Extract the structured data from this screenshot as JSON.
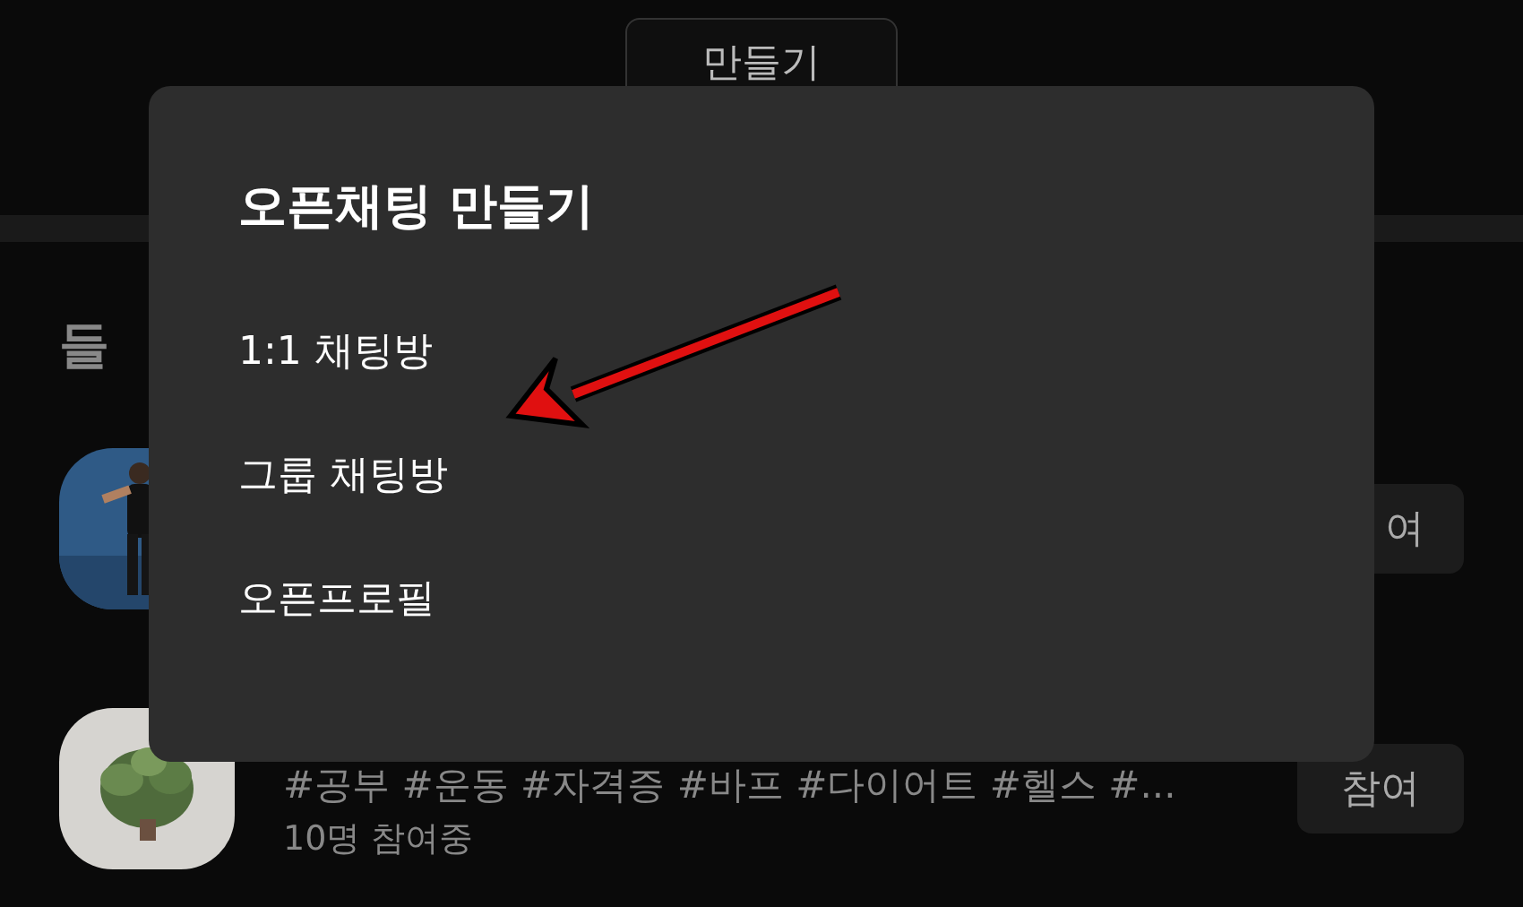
{
  "top_button": {
    "label": "만들기"
  },
  "section_title": "들",
  "rooms": [
    {
      "join_label": "여"
    },
    {
      "hashtags": "#공부 #운동 #자격증 #바프 #다이어트 #헬스 #...",
      "members": "10명 참여중",
      "join_label": "참여"
    }
  ],
  "dialog": {
    "title": "오픈채팅 만들기",
    "options": [
      "1:1 채팅방",
      "그룹 채팅방",
      "오픈프로필"
    ]
  }
}
